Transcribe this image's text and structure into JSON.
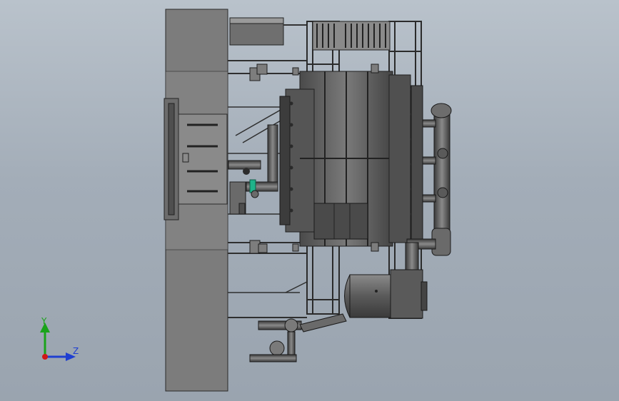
{
  "viewport": {
    "background_top": "#b9c2cb",
    "background_bottom": "#9aa4af"
  },
  "triad": {
    "y_label": "Y",
    "z_label": "Z",
    "y_color": "#1aa31a",
    "z_color": "#1f3fd1",
    "x_color": "#d01818"
  },
  "model": {
    "steel_color": "#6f6f6f",
    "dark_color": "#2c2c2c",
    "panel_color": "#7d7d7d",
    "pipe_color": "#5e5e5e",
    "valve_accent": "#1fb38a",
    "frame_color": "#3a3a3a"
  }
}
